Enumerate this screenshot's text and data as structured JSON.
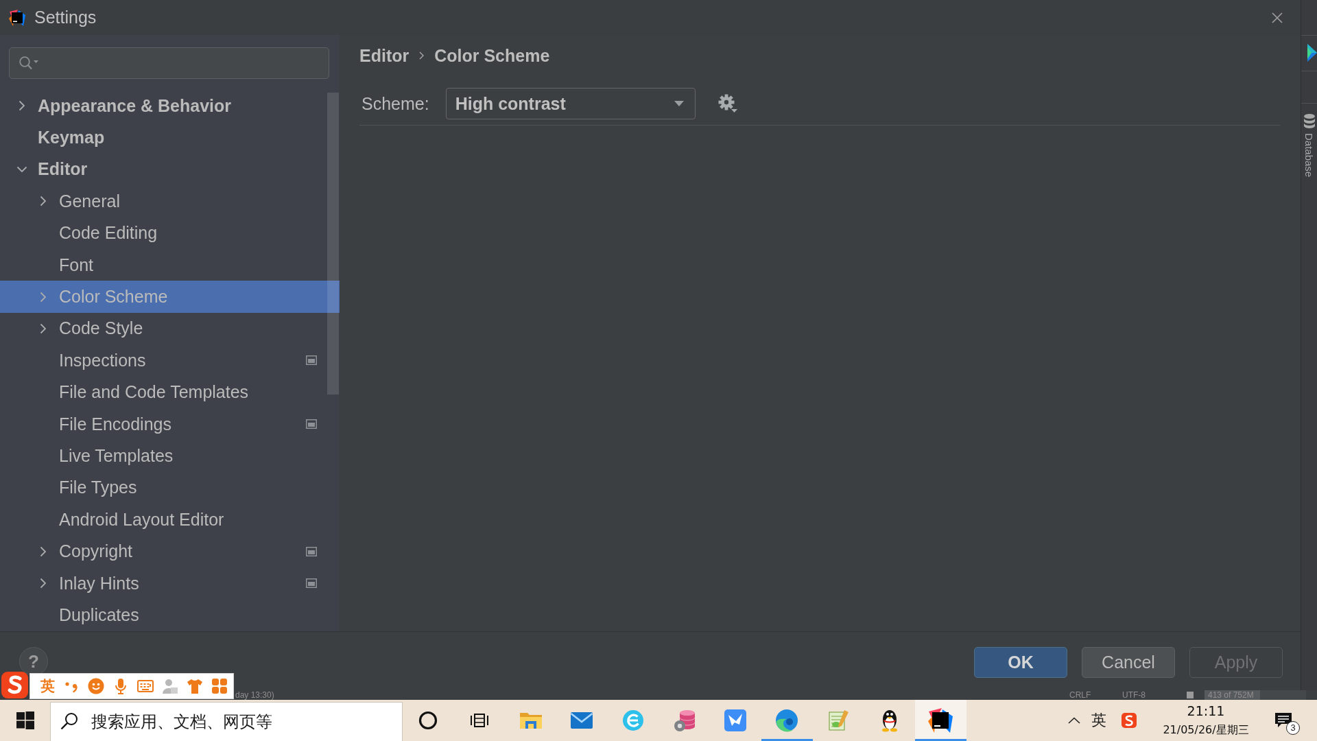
{
  "window": {
    "title": "Settings"
  },
  "sidebar": {
    "tree": [
      {
        "label": "Appearance & Behavior",
        "kind": "group",
        "expanded": false,
        "selected": false,
        "project_level": false
      },
      {
        "label": "Keymap",
        "kind": "page",
        "selected": false,
        "project_level": false
      },
      {
        "label": "Editor",
        "kind": "group",
        "expanded": true,
        "selected": false,
        "project_level": false,
        "children": [
          {
            "label": "General",
            "kind": "group",
            "expanded": false,
            "selected": false,
            "project_level": false
          },
          {
            "label": "Code Editing",
            "kind": "page",
            "selected": false,
            "project_level": false
          },
          {
            "label": "Font",
            "kind": "page",
            "selected": false,
            "project_level": false
          },
          {
            "label": "Color Scheme",
            "kind": "group",
            "expanded": false,
            "selected": true,
            "project_level": false
          },
          {
            "label": "Code Style",
            "kind": "group",
            "expanded": false,
            "selected": false,
            "project_level": false
          },
          {
            "label": "Inspections",
            "kind": "page",
            "selected": false,
            "project_level": true
          },
          {
            "label": "File and Code Templates",
            "kind": "page",
            "selected": false,
            "project_level": false
          },
          {
            "label": "File Encodings",
            "kind": "page",
            "selected": false,
            "project_level": true
          },
          {
            "label": "Live Templates",
            "kind": "page",
            "selected": false,
            "project_level": false
          },
          {
            "label": "File Types",
            "kind": "page",
            "selected": false,
            "project_level": false
          },
          {
            "label": "Android Layout Editor",
            "kind": "page",
            "selected": false,
            "project_level": false
          },
          {
            "label": "Copyright",
            "kind": "group",
            "expanded": false,
            "selected": false,
            "project_level": true
          },
          {
            "label": "Inlay Hints",
            "kind": "group",
            "expanded": false,
            "selected": false,
            "project_level": true
          },
          {
            "label": "Duplicates",
            "kind": "page",
            "selected": false,
            "project_level": false
          }
        ]
      }
    ]
  },
  "content": {
    "breadcrumb": [
      "Editor",
      "Color Scheme"
    ],
    "scheme": {
      "label": "Scheme:",
      "value": "High contrast"
    }
  },
  "footer": {
    "help": "?",
    "buttons": [
      {
        "label": "OK",
        "default": true,
        "disabled": false
      },
      {
        "label": "Cancel",
        "default": false,
        "disabled": false
      },
      {
        "label": "Apply",
        "default": false,
        "disabled": true
      }
    ]
  },
  "tool_strip": {
    "label": "Database"
  },
  "ide_status_bar": {
    "text": "day 13:30)",
    "items": [
      "CRLF",
      "UTF-8"
    ],
    "memory": {
      "reading": "413 of 752M",
      "level": 0.55
    }
  },
  "ime_toolbar": {
    "mode": "英"
  },
  "taskbar": {
    "search": {
      "placeholder": "搜索应用、文档、网页等"
    },
    "apps": [
      {
        "running": false,
        "selected": false
      },
      {
        "running": false,
        "selected": false
      },
      {
        "running": false,
        "selected": false
      },
      {
        "running": false,
        "selected": false
      },
      {
        "running": false,
        "selected": false
      },
      {
        "running": true,
        "selected": false
      },
      {
        "running": false,
        "selected": false
      },
      {
        "running": false,
        "selected": false
      },
      {
        "running": true,
        "selected": true
      }
    ],
    "tray": {
      "input_mode": "英"
    },
    "clock": {
      "time": "21:11",
      "date": "21/05/26/星期三"
    },
    "notification_count": "3"
  }
}
